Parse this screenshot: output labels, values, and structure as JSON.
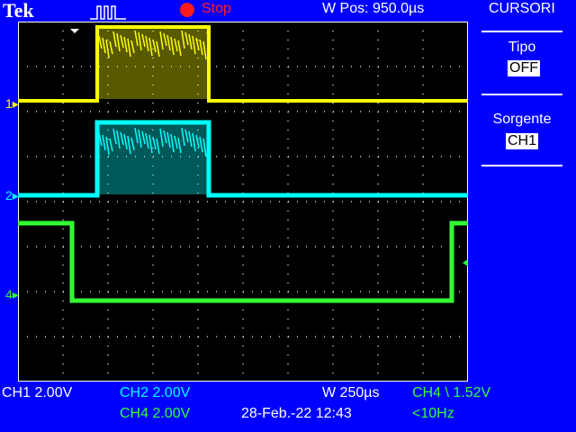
{
  "header": {
    "brand": "Tek",
    "acquisition_icon": "pulse-trigger-icon",
    "run_state": "Stop",
    "window_position": "W Pos: 950.0µs"
  },
  "side_menu": {
    "title": "CURSORI",
    "items": [
      {
        "label": "Tipo",
        "value": "OFF"
      },
      {
        "label": "Sorgente",
        "value": "CH1"
      }
    ]
  },
  "channel_markers": [
    "1",
    "2",
    "4"
  ],
  "status": {
    "ch1": "CH1  2.00V",
    "ch2": "CH2  2.00V",
    "ch4": "CH4  2.00V",
    "timebase": "W 250µs",
    "trigger": "CH4 \\ 1.52V",
    "date": "28-Feb.-22 12:43",
    "frequency": "<10Hz"
  },
  "colors": {
    "background": "#0000ff",
    "ch1": "#ffff00",
    "ch2": "#00ffff",
    "ch4": "#33ff33",
    "stop": "#ff2020"
  }
}
